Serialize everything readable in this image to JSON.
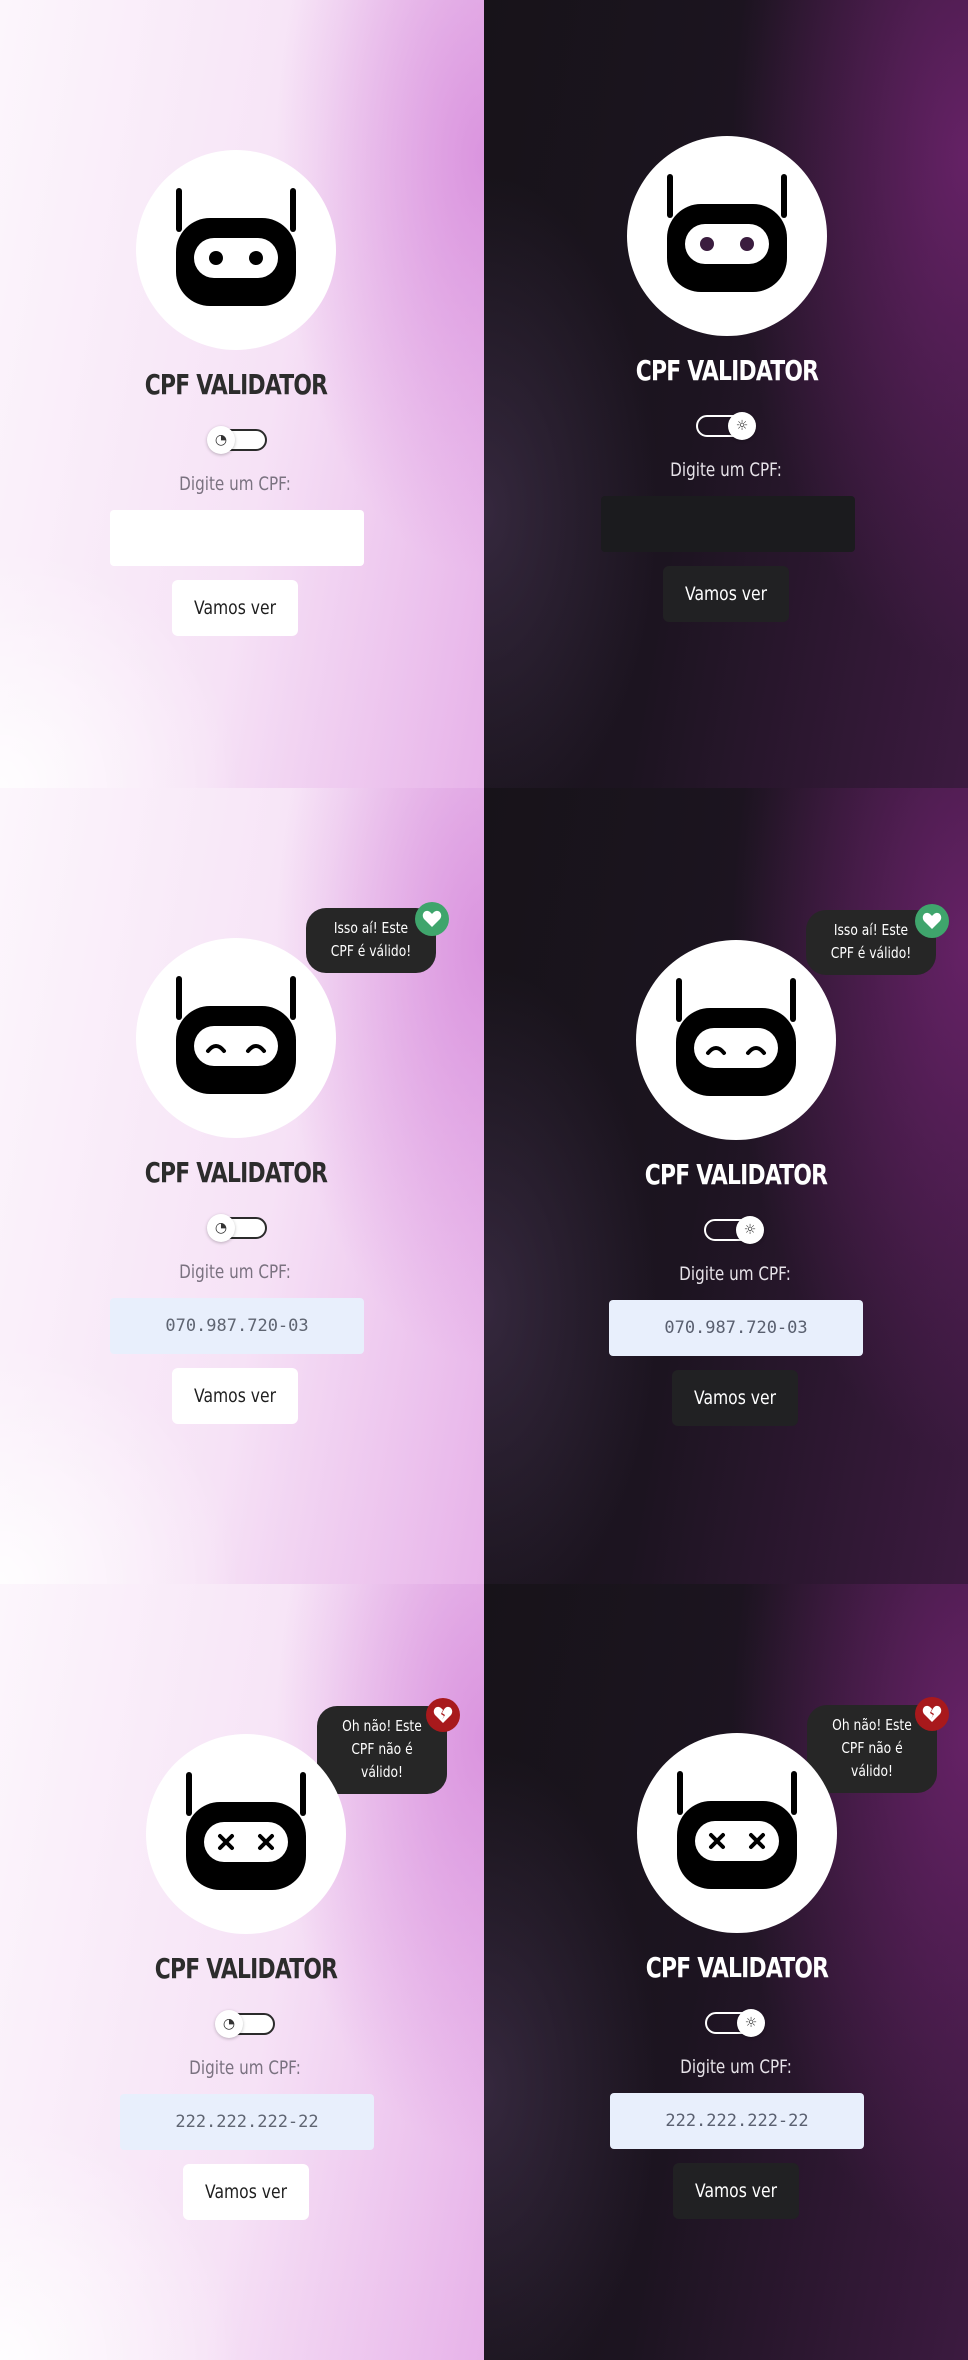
{
  "app": {
    "title": "CPF VALIDATOR",
    "input_label": "Digite um CPF:",
    "button_label": "Vamos ver"
  },
  "theme_toggle": {
    "light_icon": "moon-icon",
    "light_glyph": "◔",
    "dark_icon": "sun-icon",
    "dark_glyph": "☼"
  },
  "colors": {
    "valid_badge": "#3fa56c",
    "invalid_badge": "#a8191c",
    "input_filled_bg": "#e8effc",
    "bubble_bg": "#262626"
  },
  "states": {
    "idle": {
      "robot_face": "neutral-eyes",
      "input_value": ""
    },
    "valid": {
      "robot_face": "happy-eyes",
      "input_value": "070.987.720-03",
      "bubble": "Isso aí! Este CPF é válido!",
      "badge_icon": "heart-icon"
    },
    "invalid": {
      "robot_face": "x-eyes",
      "input_value": "222.222.222-22",
      "bubble": "Oh não! Este CPF não é válido!",
      "badge_icon": "broken-heart-icon"
    }
  }
}
